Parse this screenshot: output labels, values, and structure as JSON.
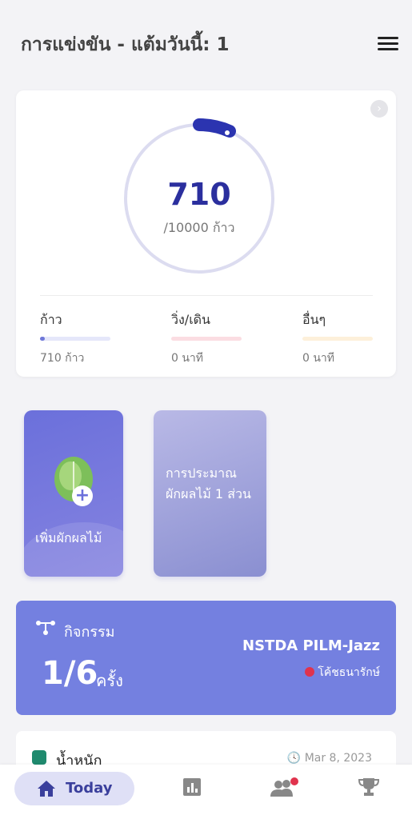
{
  "header": {
    "title": "การแข่งขัน - แต้มวันนี้: 1"
  },
  "steps": {
    "value": "710",
    "goal": "/10000 ก้าว",
    "progress": 0.071
  },
  "stats": [
    {
      "label": "ก้าว",
      "value": "710 ก้าว",
      "color": "#e5e7fa",
      "progress": 0.071,
      "fill": "#6f78d8"
    },
    {
      "label": "วิ่ง/เดิน",
      "value": "0 นาที",
      "color": "#fbdde2",
      "progress": 0,
      "fill": "#e67a8f"
    },
    {
      "label": "อื่นๆ",
      "value": "0 นาที",
      "color": "#fdf0da",
      "progress": 0,
      "fill": "#e9b66a"
    }
  ],
  "tiles": {
    "add_veg": "เพิ่มผักผลไม้",
    "estimate": "การประมาณ ผักผลไม้ 1 ส่วน"
  },
  "activity": {
    "label": "กิจกรรม",
    "count": "1/6",
    "unit": "ครั้ง",
    "team": "NSTDA PILM-Jazz",
    "coach": "โค้ชธนารักษ์"
  },
  "weight": {
    "label": "น้ำหนัก",
    "date": "Mar 8, 2023"
  },
  "nav": {
    "today": "Today"
  }
}
